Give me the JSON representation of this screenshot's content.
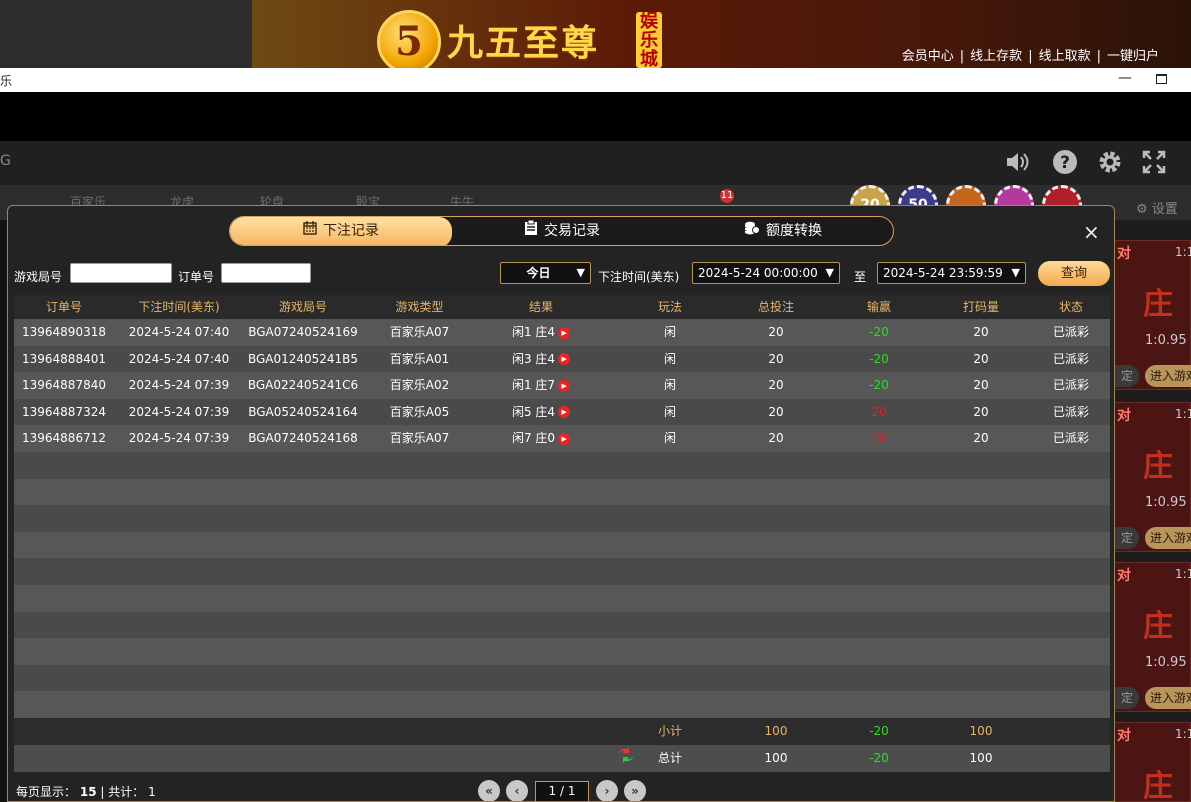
{
  "banner": {
    "logo_mark": "5",
    "logo_text": "九五至尊",
    "logo_sub": "娱乐城",
    "links": [
      "会员中心",
      "线上存款",
      "线上取款",
      "一键归户"
    ],
    "separator": "|"
  },
  "window": {
    "title": "乐",
    "minimize": "—"
  },
  "game_bg": {
    "left_label": "G",
    "tabs": [
      "百家乐",
      "龙虎",
      "轮盘",
      "骰宝",
      "牛牛"
    ],
    "chips": [
      "20",
      "50"
    ],
    "settings": "设置",
    "right_cards": [
      {
        "tag": "对",
        "ratio_top": "1:1",
        "big": "庄",
        "ratio": "1:0.95",
        "enter": "进入游戏",
        "pill": "定"
      },
      {
        "tag": "对",
        "ratio_top": "1:1",
        "big": "庄",
        "ratio": "1:0.95",
        "enter": "进入游戏",
        "pill": "定"
      },
      {
        "tag": "对",
        "ratio_top": "1:1",
        "big": "庄",
        "ratio": "1:0.95",
        "enter": "进入游戏",
        "pill": "定"
      },
      {
        "tag": "对",
        "ratio_top": "1:1",
        "big": "庄",
        "ratio": "",
        "enter": "",
        "pill": ""
      }
    ],
    "badge": "11"
  },
  "modal": {
    "tabs": [
      {
        "label": "下注记录",
        "icon": "calendar-icon",
        "active": true
      },
      {
        "label": "交易记录",
        "icon": "clipboard-icon",
        "active": false
      },
      {
        "label": "额度转换",
        "icon": "coins-icon",
        "active": false
      }
    ],
    "close": "×",
    "filters": {
      "game_id_label": "游戏局号",
      "game_id_value": "",
      "order_label": "订单号",
      "order_value": "",
      "period_value": "今日",
      "time_label": "下注时间(美东)",
      "start": "2024-5-24 00:00:00",
      "to_label": "至",
      "end": "2024-5-24 23:59:59",
      "query": "查询"
    },
    "table": {
      "headers": [
        "订单号",
        "下注时间(美东)",
        "游戏局号",
        "游戏类型",
        "结果",
        "玩法",
        "总投注",
        "输赢",
        "打码量",
        "状态"
      ],
      "rows": [
        {
          "order": "13964890318",
          "time": "2024-5-24 07:40",
          "round": "BGA07240524169",
          "type": "百家乐A07",
          "result": "闲1 庄4",
          "play": "闲",
          "bet": "20",
          "win": "-20",
          "win_color": "green",
          "code": "20",
          "status": "已派彩"
        },
        {
          "order": "13964888401",
          "time": "2024-5-24 07:40",
          "round": "BGA012405241B5",
          "type": "百家乐A01",
          "result": "闲3 庄4",
          "play": "闲",
          "bet": "20",
          "win": "-20",
          "win_color": "green",
          "code": "20",
          "status": "已派彩"
        },
        {
          "order": "13964887840",
          "time": "2024-5-24 07:39",
          "round": "BGA022405241C6",
          "type": "百家乐A02",
          "result": "闲1 庄7",
          "play": "闲",
          "bet": "20",
          "win": "-20",
          "win_color": "green",
          "code": "20",
          "status": "已派彩"
        },
        {
          "order": "13964887324",
          "time": "2024-5-24 07:39",
          "round": "BGA05240524164",
          "type": "百家乐A05",
          "result": "闲5 庄4",
          "play": "闲",
          "bet": "20",
          "win": "20",
          "win_color": "red",
          "code": "20",
          "status": "已派彩"
        },
        {
          "order": "13964886712",
          "time": "2024-5-24 07:39",
          "round": "BGA07240524168",
          "type": "百家乐A07",
          "result": "闲7 庄0",
          "play": "闲",
          "bet": "20",
          "win": "20",
          "win_color": "red",
          "code": "20",
          "status": "已派彩"
        }
      ],
      "empty_rows": 10
    },
    "subtotal": {
      "label": "小计",
      "bet": "100",
      "win": "-20",
      "code": "100"
    },
    "total": {
      "label": "总计",
      "bet": "100",
      "win": "-20",
      "code": "100"
    },
    "pager": {
      "per_page_label": "每页显示：",
      "per_page": "15",
      "sep": "|",
      "total_label": "共计：",
      "total": "1",
      "page": "1 / 1",
      "first": "«",
      "prev": "‹",
      "next": "›",
      "last": "»"
    }
  },
  "colors": {
    "accent": "#f5b55e",
    "win_negative": "#2bdc2b",
    "win_positive": "#e02020"
  }
}
